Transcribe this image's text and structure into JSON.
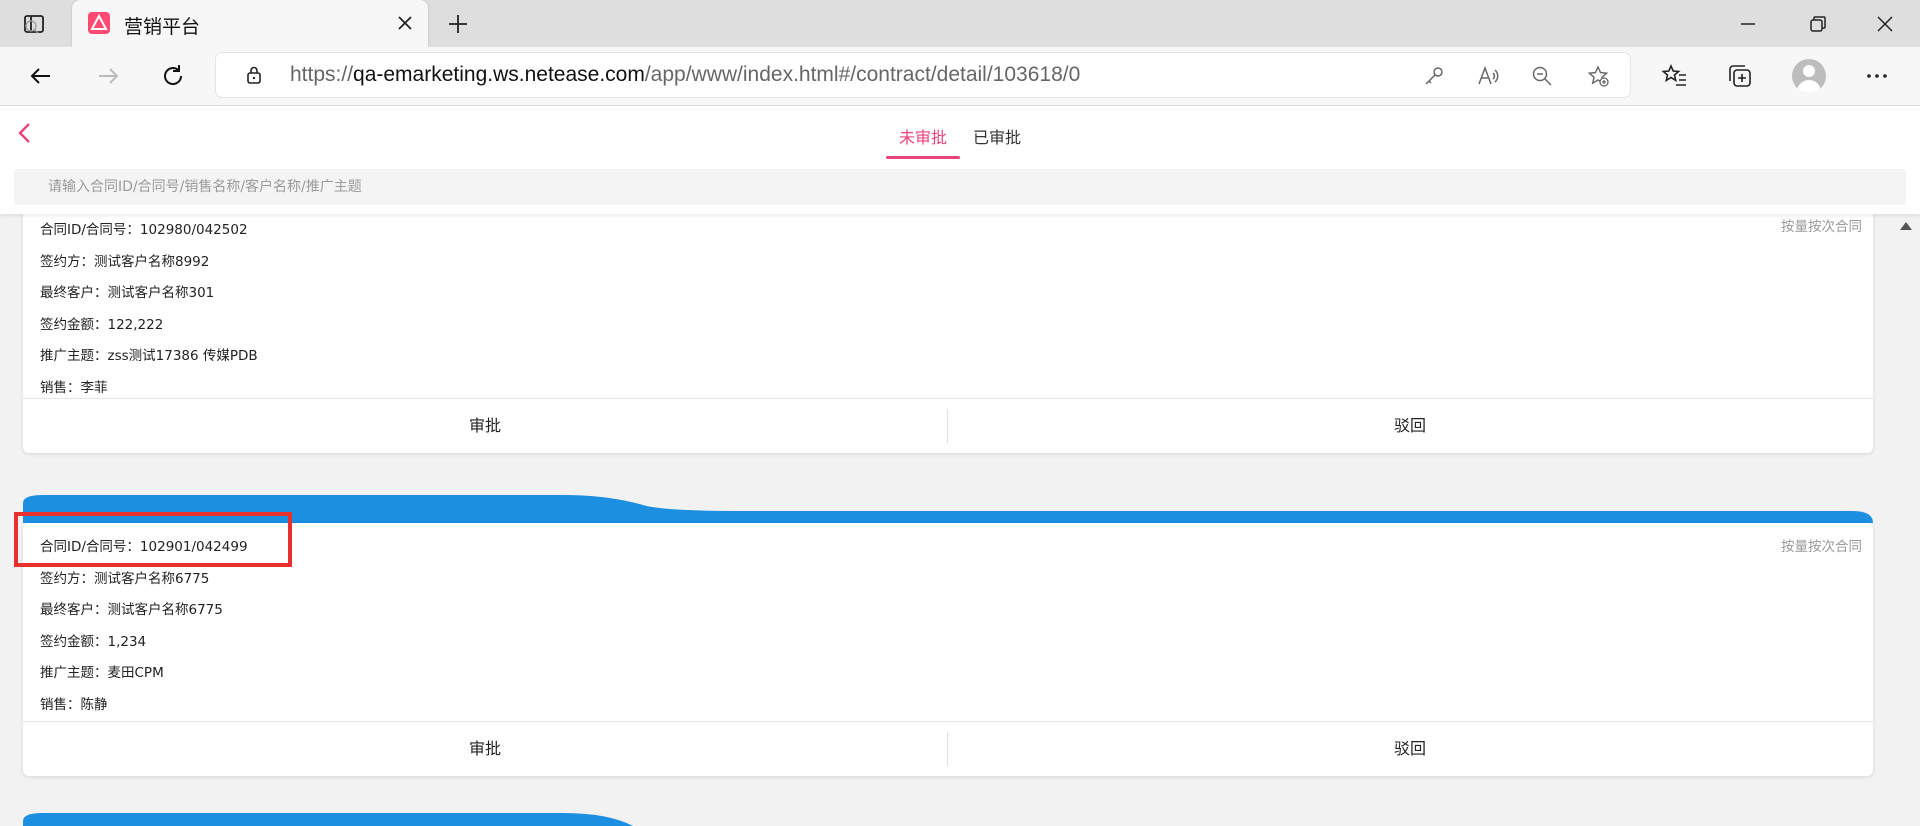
{
  "browser": {
    "tab_title": "营销平台",
    "url_prefix": "https://",
    "url_host": "qa-emarketing.ws.netease.com",
    "url_path": "/app/www/index.html#/contract/detail/103618/0",
    "accent_color": "#e8437c"
  },
  "page": {
    "tabs": [
      {
        "label": "未审批",
        "active": true
      },
      {
        "label": "已审批",
        "active": false
      }
    ],
    "search": {
      "placeholder": "请输入合同ID/合同号/销售名称/客户名称/推广主题",
      "value": ""
    },
    "cards": [
      {
        "tag": "按量按次合同",
        "lines": [
          "合同ID/合同号：102980/042502",
          "签约方：测试客户名称8992",
          "最终客户：测试客户名称301",
          "签约金额：122,222",
          "推广主题：zss测试17386 传媒PDB",
          "销售：李菲"
        ],
        "approve_label": "审批",
        "reject_label": "驳回"
      },
      {
        "tag": "按量按次合同",
        "lines": [
          "合同ID/合同号：102901/042499",
          "签约方：测试客户名称6775",
          "最终客户：测试客户名称6775",
          "签约金额：1,234",
          "推广主题：麦田CPM",
          "销售：陈静"
        ],
        "approve_label": "审批",
        "reject_label": "驳回"
      }
    ]
  }
}
